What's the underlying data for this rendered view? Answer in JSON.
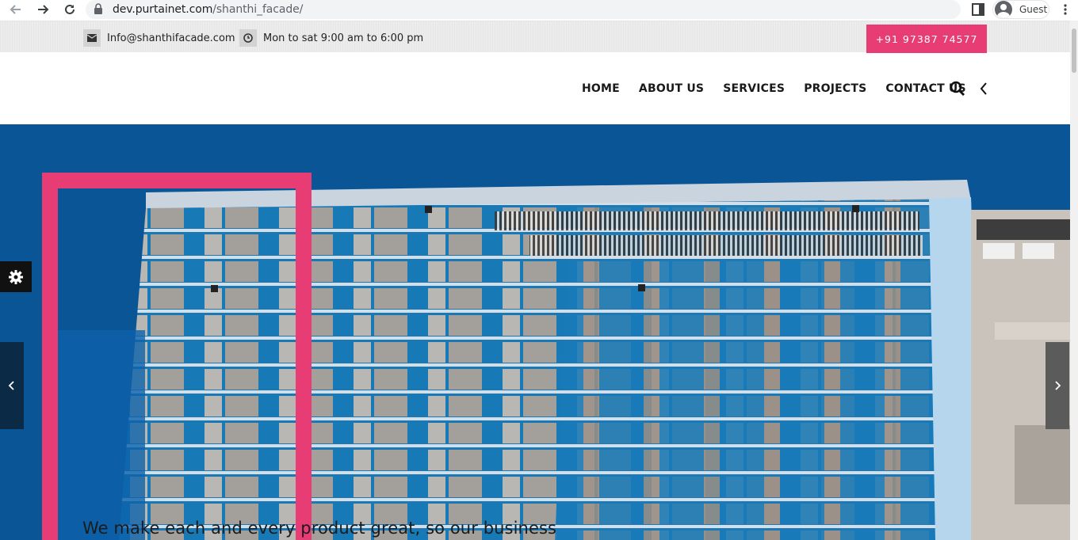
{
  "browser": {
    "url_domain": "dev.purtainet.com",
    "url_path": "/shanthi_facade/",
    "profile_name": "Guest"
  },
  "topbar": {
    "email": "Info@shanthifacade.com",
    "hours": "Mon to sat 9:00 am to 6:00 pm",
    "phone": "+91 97387 74577"
  },
  "nav": {
    "items": [
      {
        "label": "HOME"
      },
      {
        "label": "ABOUT US"
      },
      {
        "label": "SERVICES"
      },
      {
        "label": "PROJECTS"
      },
      {
        "label": "CONTACT US"
      }
    ]
  },
  "hero": {
    "headline": "We make each and every product great, so our business"
  },
  "colors": {
    "accent_pink": "#e83c74",
    "hero_blue": "#0a5596"
  },
  "icons": [
    "envelope-icon",
    "clock-icon",
    "search-icon",
    "chevron-left-icon",
    "gear-icon",
    "chevron-right-icon"
  ]
}
